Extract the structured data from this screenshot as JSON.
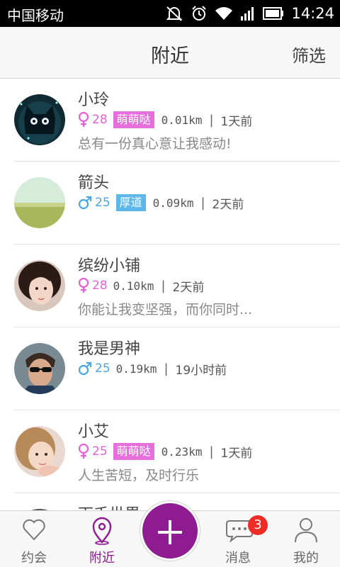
{
  "status_bar": {
    "carrier": "中国移动",
    "time": "14:24",
    "icons": [
      "mute-icon",
      "alarm-icon",
      "wifi-icon",
      "signal-icon",
      "battery-icon"
    ]
  },
  "header": {
    "title": "附近",
    "filter_label": "筛选"
  },
  "users": [
    {
      "name": "小玲",
      "gender": "female",
      "age": "28",
      "tag": "萌萌哒",
      "tag_color": "#e66fdd",
      "distance": "0.01km",
      "last_active": "1天前",
      "bio": "总有一份真心意让我感动!"
    },
    {
      "name": "箭头",
      "gender": "male",
      "age": "25",
      "tag": "厚道",
      "tag_color": "#5db7ea",
      "distance": "0.09km",
      "last_active": "2天前",
      "bio": ""
    },
    {
      "name": "缤纷小铺",
      "gender": "female",
      "age": "28",
      "tag": "",
      "distance": "0.10km",
      "last_active": "2天前",
      "bio": "你能让我变坚强，而你同时..."
    },
    {
      "name": "我是男神",
      "gender": "male",
      "age": "25",
      "tag": "",
      "distance": "0.19km",
      "last_active": "19小时前",
      "bio": ""
    },
    {
      "name": "小艾",
      "gender": "female",
      "age": "25",
      "tag": "萌萌哒",
      "tag_color": "#e66fdd",
      "distance": "0.23km",
      "last_active": "1天前",
      "bio": "人生苦短，及时行乐"
    },
    {
      "name": "下千世界",
      "gender": "",
      "age": "",
      "tag": "",
      "distance": "",
      "last_active": "",
      "bio": ""
    }
  ],
  "tabs": [
    {
      "label": "约会",
      "icon": "heart-icon",
      "active": false
    },
    {
      "label": "附近",
      "icon": "location-pin-icon",
      "active": true
    },
    {
      "label": "消息",
      "icon": "chat-bubble-icon",
      "active": false,
      "badge": "3"
    },
    {
      "label": "我的",
      "icon": "person-icon",
      "active": false
    }
  ],
  "colors": {
    "accent": "#8e1b91",
    "female": "#e75fd8",
    "male": "#4aa6e0",
    "badge": "#ee2b24"
  }
}
